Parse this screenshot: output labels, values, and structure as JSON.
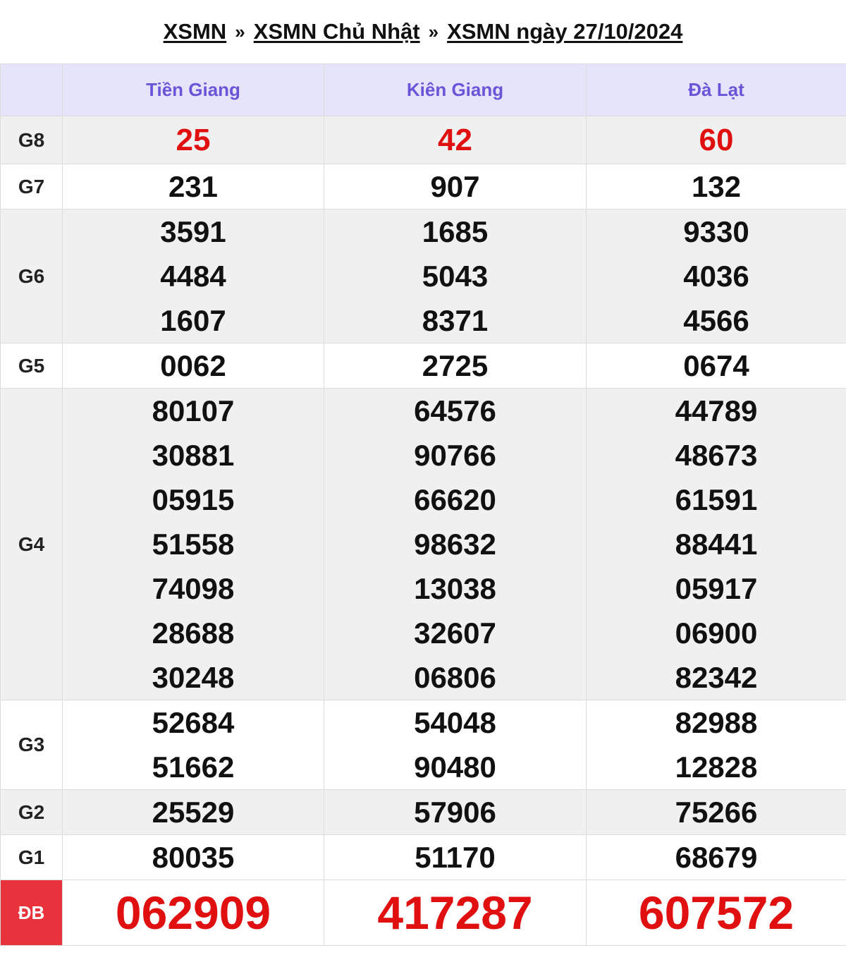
{
  "breadcrumb": {
    "item1": "XSMN",
    "item2": "XSMN Chủ Nhật",
    "item3": "XSMN ngày 27/10/2024",
    "separator": "»"
  },
  "provinces": [
    "Tiền Giang",
    "Kiên Giang",
    "Đà Lạt"
  ],
  "rows": [
    {
      "label": "G8",
      "values": [
        [
          "25"
        ],
        [
          "42"
        ],
        [
          "60"
        ]
      ]
    },
    {
      "label": "G7",
      "values": [
        [
          "231"
        ],
        [
          "907"
        ],
        [
          "132"
        ]
      ]
    },
    {
      "label": "G6",
      "values": [
        [
          "3591",
          "4484",
          "1607"
        ],
        [
          "1685",
          "5043",
          "8371"
        ],
        [
          "9330",
          "4036",
          "4566"
        ]
      ]
    },
    {
      "label": "G5",
      "values": [
        [
          "0062"
        ],
        [
          "2725"
        ],
        [
          "0674"
        ]
      ]
    },
    {
      "label": "G4",
      "values": [
        [
          "80107",
          "30881",
          "05915",
          "51558",
          "74098",
          "28688",
          "30248"
        ],
        [
          "64576",
          "90766",
          "66620",
          "98632",
          "13038",
          "32607",
          "06806"
        ],
        [
          "44789",
          "48673",
          "61591",
          "88441",
          "05917",
          "06900",
          "82342"
        ]
      ]
    },
    {
      "label": "G3",
      "values": [
        [
          "52684",
          "51662"
        ],
        [
          "54048",
          "90480"
        ],
        [
          "82988",
          "12828"
        ]
      ]
    },
    {
      "label": "G2",
      "values": [
        [
          "25529"
        ],
        [
          "57906"
        ],
        [
          "75266"
        ]
      ]
    },
    {
      "label": "G1",
      "values": [
        [
          "80035"
        ],
        [
          "51170"
        ],
        [
          "68679"
        ]
      ]
    },
    {
      "label": "ĐB",
      "values": [
        [
          "062909"
        ],
        [
          "417287"
        ],
        [
          "607572"
        ]
      ]
    }
  ],
  "colors": {
    "header_bg": "#e6e4fb",
    "header_text": "#6a55d8",
    "highlight_red": "#e01010",
    "special_label_bg": "#e8323c",
    "alt_row_bg": "#f0f0f0"
  }
}
